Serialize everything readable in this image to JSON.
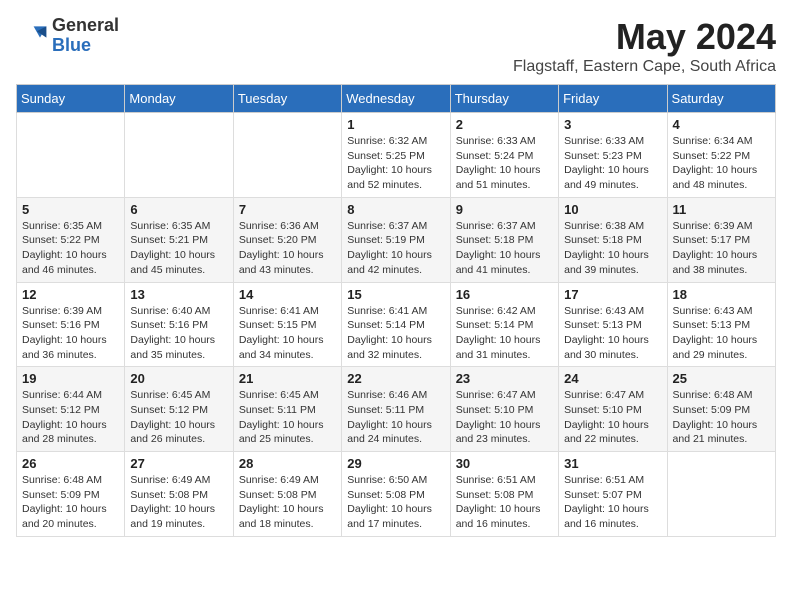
{
  "header": {
    "logo_general": "General",
    "logo_blue": "Blue",
    "month_year": "May 2024",
    "location": "Flagstaff, Eastern Cape, South Africa"
  },
  "days_of_week": [
    "Sunday",
    "Monday",
    "Tuesday",
    "Wednesday",
    "Thursday",
    "Friday",
    "Saturday"
  ],
  "weeks": [
    [
      {
        "day": "",
        "info": ""
      },
      {
        "day": "",
        "info": ""
      },
      {
        "day": "",
        "info": ""
      },
      {
        "day": "1",
        "info": "Sunrise: 6:32 AM\nSunset: 5:25 PM\nDaylight: 10 hours and 52 minutes."
      },
      {
        "day": "2",
        "info": "Sunrise: 6:33 AM\nSunset: 5:24 PM\nDaylight: 10 hours and 51 minutes."
      },
      {
        "day": "3",
        "info": "Sunrise: 6:33 AM\nSunset: 5:23 PM\nDaylight: 10 hours and 49 minutes."
      },
      {
        "day": "4",
        "info": "Sunrise: 6:34 AM\nSunset: 5:22 PM\nDaylight: 10 hours and 48 minutes."
      }
    ],
    [
      {
        "day": "5",
        "info": "Sunrise: 6:35 AM\nSunset: 5:22 PM\nDaylight: 10 hours and 46 minutes."
      },
      {
        "day": "6",
        "info": "Sunrise: 6:35 AM\nSunset: 5:21 PM\nDaylight: 10 hours and 45 minutes."
      },
      {
        "day": "7",
        "info": "Sunrise: 6:36 AM\nSunset: 5:20 PM\nDaylight: 10 hours and 43 minutes."
      },
      {
        "day": "8",
        "info": "Sunrise: 6:37 AM\nSunset: 5:19 PM\nDaylight: 10 hours and 42 minutes."
      },
      {
        "day": "9",
        "info": "Sunrise: 6:37 AM\nSunset: 5:18 PM\nDaylight: 10 hours and 41 minutes."
      },
      {
        "day": "10",
        "info": "Sunrise: 6:38 AM\nSunset: 5:18 PM\nDaylight: 10 hours and 39 minutes."
      },
      {
        "day": "11",
        "info": "Sunrise: 6:39 AM\nSunset: 5:17 PM\nDaylight: 10 hours and 38 minutes."
      }
    ],
    [
      {
        "day": "12",
        "info": "Sunrise: 6:39 AM\nSunset: 5:16 PM\nDaylight: 10 hours and 36 minutes."
      },
      {
        "day": "13",
        "info": "Sunrise: 6:40 AM\nSunset: 5:16 PM\nDaylight: 10 hours and 35 minutes."
      },
      {
        "day": "14",
        "info": "Sunrise: 6:41 AM\nSunset: 5:15 PM\nDaylight: 10 hours and 34 minutes."
      },
      {
        "day": "15",
        "info": "Sunrise: 6:41 AM\nSunset: 5:14 PM\nDaylight: 10 hours and 32 minutes."
      },
      {
        "day": "16",
        "info": "Sunrise: 6:42 AM\nSunset: 5:14 PM\nDaylight: 10 hours and 31 minutes."
      },
      {
        "day": "17",
        "info": "Sunrise: 6:43 AM\nSunset: 5:13 PM\nDaylight: 10 hours and 30 minutes."
      },
      {
        "day": "18",
        "info": "Sunrise: 6:43 AM\nSunset: 5:13 PM\nDaylight: 10 hours and 29 minutes."
      }
    ],
    [
      {
        "day": "19",
        "info": "Sunrise: 6:44 AM\nSunset: 5:12 PM\nDaylight: 10 hours and 28 minutes."
      },
      {
        "day": "20",
        "info": "Sunrise: 6:45 AM\nSunset: 5:12 PM\nDaylight: 10 hours and 26 minutes."
      },
      {
        "day": "21",
        "info": "Sunrise: 6:45 AM\nSunset: 5:11 PM\nDaylight: 10 hours and 25 minutes."
      },
      {
        "day": "22",
        "info": "Sunrise: 6:46 AM\nSunset: 5:11 PM\nDaylight: 10 hours and 24 minutes."
      },
      {
        "day": "23",
        "info": "Sunrise: 6:47 AM\nSunset: 5:10 PM\nDaylight: 10 hours and 23 minutes."
      },
      {
        "day": "24",
        "info": "Sunrise: 6:47 AM\nSunset: 5:10 PM\nDaylight: 10 hours and 22 minutes."
      },
      {
        "day": "25",
        "info": "Sunrise: 6:48 AM\nSunset: 5:09 PM\nDaylight: 10 hours and 21 minutes."
      }
    ],
    [
      {
        "day": "26",
        "info": "Sunrise: 6:48 AM\nSunset: 5:09 PM\nDaylight: 10 hours and 20 minutes."
      },
      {
        "day": "27",
        "info": "Sunrise: 6:49 AM\nSunset: 5:08 PM\nDaylight: 10 hours and 19 minutes."
      },
      {
        "day": "28",
        "info": "Sunrise: 6:49 AM\nSunset: 5:08 PM\nDaylight: 10 hours and 18 minutes."
      },
      {
        "day": "29",
        "info": "Sunrise: 6:50 AM\nSunset: 5:08 PM\nDaylight: 10 hours and 17 minutes."
      },
      {
        "day": "30",
        "info": "Sunrise: 6:51 AM\nSunset: 5:08 PM\nDaylight: 10 hours and 16 minutes."
      },
      {
        "day": "31",
        "info": "Sunrise: 6:51 AM\nSunset: 5:07 PM\nDaylight: 10 hours and 16 minutes."
      },
      {
        "day": "",
        "info": ""
      }
    ]
  ]
}
